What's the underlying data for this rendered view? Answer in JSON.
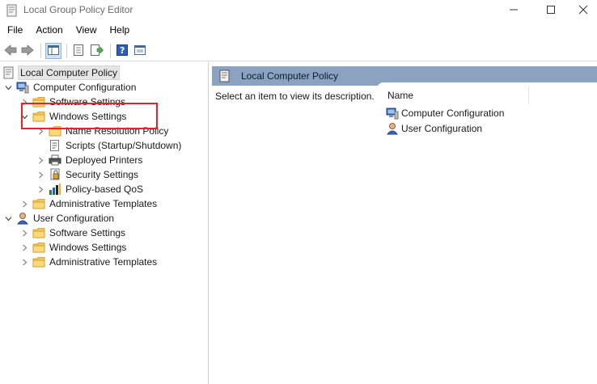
{
  "window": {
    "title": "Local Group Policy Editor",
    "app_icon": "policy-doc-icon",
    "controls": [
      "minimize-icon",
      "maximize-icon",
      "close-icon"
    ]
  },
  "menu": {
    "items": [
      "File",
      "Action",
      "View",
      "Help"
    ]
  },
  "toolbar": {
    "buttons": [
      "back-arrow-icon",
      "forward-arrow-icon",
      "show-hide-tree-icon",
      "properties-icon",
      "export-list-icon",
      "help-icon",
      "console-view-icon"
    ]
  },
  "tree": {
    "root": "Local Computer Policy",
    "computer_config": "Computer Configuration",
    "cc_software": "Software Settings",
    "cc_windows": "Windows Settings",
    "ws_name_resolution": "Name Resolution Policy",
    "ws_scripts": "Scripts (Startup/Shutdown)",
    "ws_printers": "Deployed Printers",
    "ws_security": "Security Settings",
    "ws_qos": "Policy-based QoS",
    "cc_admin": "Administrative Templates",
    "user_config": "User Configuration",
    "uc_software": "Software Settings",
    "uc_windows": "Windows Settings",
    "uc_admin": "Administrative Templates"
  },
  "right_pane": {
    "header_title": "Local Computer Policy",
    "description": "Select an item to view its description.",
    "column_name": "Name",
    "items": [
      "Computer Configuration",
      "User Configuration"
    ]
  },
  "colors": {
    "header_bar": "#8ba3c1",
    "highlight_box": "#e3242b",
    "folder": "#f5c75a"
  }
}
